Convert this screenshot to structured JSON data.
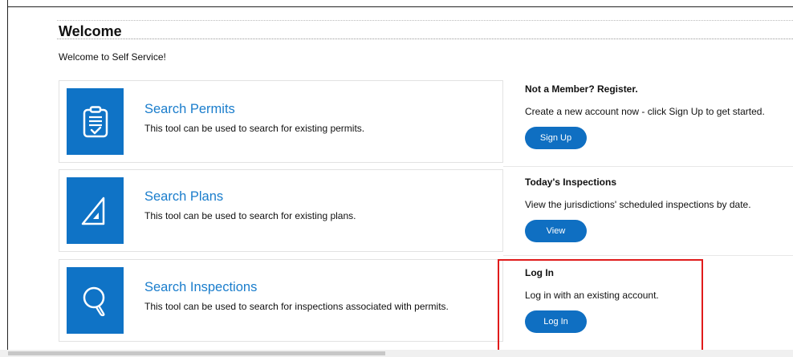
{
  "header": {
    "title": "Welcome",
    "subtitle": "Welcome to Self Service!"
  },
  "cards": [
    {
      "title": "Search Permits",
      "description": "This tool can be used to search for existing permits.",
      "icon": "clipboard-check-icon"
    },
    {
      "title": "Search Plans",
      "description": "This tool can be used to search for existing plans.",
      "icon": "triangle-ruler-icon"
    },
    {
      "title": "Search Inspections",
      "description": "This tool can be used to search for inspections associated with permits.",
      "icon": "magnifier-icon"
    }
  ],
  "sidebar": {
    "register": {
      "title": "Not a Member? Register.",
      "description": "Create a new account now - click Sign Up to get started.",
      "button": "Sign Up"
    },
    "inspections": {
      "title": "Today's Inspections",
      "description": "View the jurisdictions' scheduled inspections by date.",
      "button": "View"
    },
    "login": {
      "title": "Log In",
      "description": "Log in with an existing account.",
      "button": "Log In"
    }
  },
  "colors": {
    "brand": "#0f73c6",
    "link": "#1a7dcc",
    "highlight": "#e01b1b"
  }
}
